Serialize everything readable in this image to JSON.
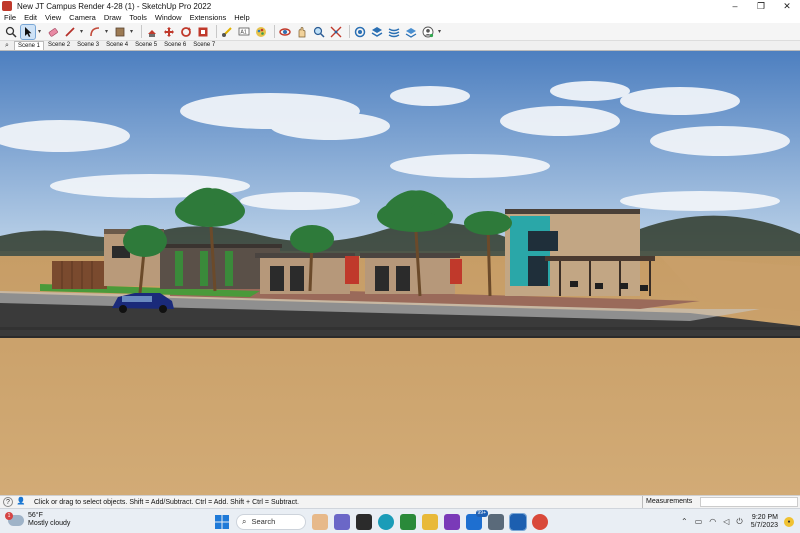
{
  "window": {
    "title": "New JT Campus Render 4-28 (1) - SketchUp Pro 2022",
    "controls": [
      "–",
      "❐",
      "✕"
    ]
  },
  "menu": {
    "items": [
      "File",
      "Edit",
      "View",
      "Camera",
      "Draw",
      "Tools",
      "Window",
      "Extensions",
      "Help"
    ]
  },
  "toolbar": {
    "tools": [
      "search-tool",
      "select-tool",
      "eraser-tool",
      "line-tool",
      "arc-tool",
      "shape-tool",
      "push-pull-tool",
      "move-tool",
      "rotate-tool",
      "offset-tool",
      "tape-measure-tool",
      "text-tool",
      "paint-bucket-tool",
      "orbit-tool",
      "pan-tool",
      "zoom-tool",
      "zoom-extents-tool",
      "warehouse-tool",
      "extension-warehouse-tool",
      "layout-tool",
      "sandbox-tool",
      "account-tool"
    ]
  },
  "scenes": {
    "search_icon": "⌕",
    "tabs": [
      "Scene 1",
      "Scene 2",
      "Scene 3",
      "Scene 4",
      "Scene 5",
      "Scene 6",
      "Scene 7"
    ],
    "active_index": 0
  },
  "status": {
    "hint": "Click or drag to select objects. Shift = Add/Subtract. Ctrl = Add. Shift + Ctrl = Subtract.",
    "measurements_label": "Measurements"
  },
  "taskbar": {
    "weather": {
      "temp": "56°F",
      "condition": "Mostly cloudy",
      "badge": "1"
    },
    "search_label": "Search",
    "badge_count": "99+",
    "time": "9:20 PM",
    "date": "5/7/2023"
  },
  "colors": {
    "sky_top": "#4d7fc0",
    "sky_bottom": "#b9d0e6",
    "ground": "#c9a06a",
    "road": "#3b3b3b",
    "accent_building": "#2aa7a8"
  }
}
